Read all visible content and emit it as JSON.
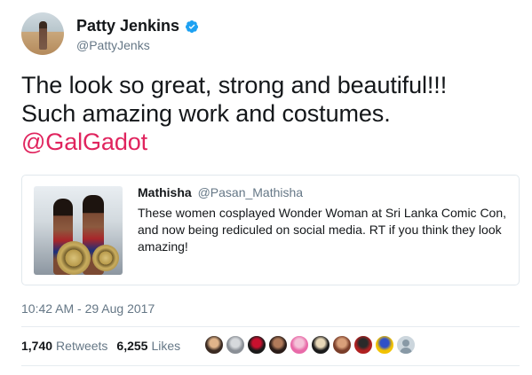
{
  "author": {
    "name": "Patty Jenkins",
    "handle": "@PattyJenks",
    "verified_color": "#1da1f2"
  },
  "tweet": {
    "text_line1": "The look so great, strong and beautiful!!!",
    "text_line2": "Such amazing work and costumes.",
    "mention": "@GalGadot"
  },
  "quoted_tweet": {
    "name": "Mathisha",
    "handle": "@Pasan_Mathisha",
    "text": "These women cosplayed Wonder Woman at Sri Lanka Comic Con, and now being rediculed on social media. RT if you think they look amazing!"
  },
  "timestamp": "10:42 AM - 29 Aug 2017",
  "stats": {
    "retweets_count": "1,740",
    "retweets_label": "Retweets",
    "likes_count": "6,255",
    "likes_label": "Likes"
  },
  "likers": [
    {
      "color1": "#3a2a22",
      "color2": "#e0b48a"
    },
    {
      "color1": "#8a8f96",
      "color2": "#d6d9dc"
    },
    {
      "color1": "#1a1a1a",
      "color2": "#c8102e"
    },
    {
      "color1": "#2a1c18",
      "color2": "#b07a5a"
    },
    {
      "color1": "#e86aa8",
      "color2": "#f4c2d8"
    },
    {
      "color1": "#1b1b1b",
      "color2": "#e8d8b8"
    },
    {
      "color1": "#7a3e2a",
      "color2": "#d9a07a"
    },
    {
      "color1": "#b02020",
      "color2": "#2a2a2a"
    },
    {
      "color1": "#f2c200",
      "color2": "#3050c8"
    },
    {
      "color1": "default",
      "color2": "default"
    }
  ],
  "colors": {
    "mention": "#e0245e",
    "secondary_text": "#657786",
    "border": "#e1e8ed"
  }
}
